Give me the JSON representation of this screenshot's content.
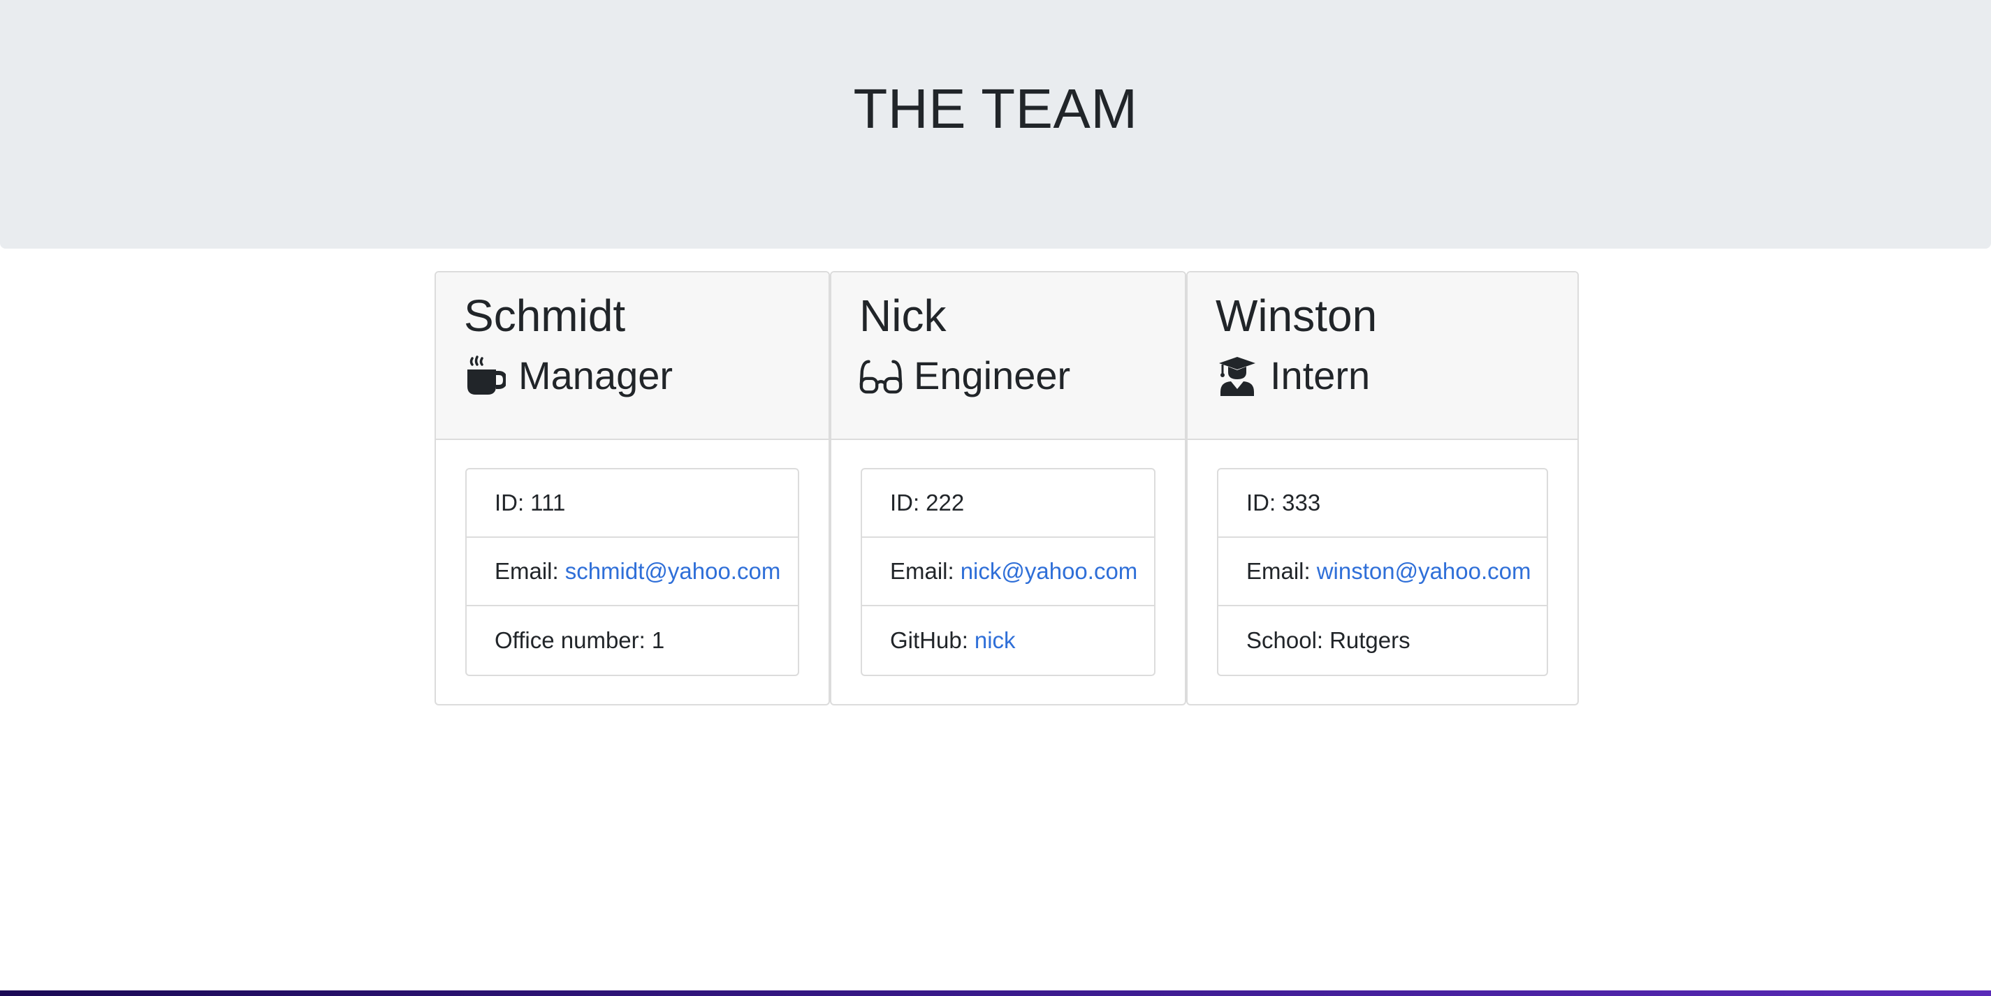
{
  "header": {
    "title": "THE TEAM"
  },
  "team": [
    {
      "name": "Schmidt",
      "role": "Manager",
      "icon": "coffee-mug-icon",
      "id_label": "ID:",
      "id": "111",
      "email_label": "Email:",
      "email": "schmidt@yahoo.com",
      "extra_label": "Office number:",
      "extra_value": "1"
    },
    {
      "name": "Nick",
      "role": "Engineer",
      "icon": "glasses-icon",
      "id_label": "ID:",
      "id": "222",
      "email_label": "Email:",
      "email": "nick@yahoo.com",
      "extra_label": "GitHub:",
      "extra_value": "nick"
    },
    {
      "name": "Winston",
      "role": "Intern",
      "icon": "graduate-icon",
      "id_label": "ID:",
      "id": "333",
      "email_label": "Email:",
      "email": "winston@yahoo.com",
      "extra_label": "School:",
      "extra_value": "Rutgers"
    }
  ],
  "colors": {
    "jumbotron_bg": "#e9ecef",
    "link": "#2f6fd8",
    "card_header_bg": "#f7f7f7",
    "border": "#dcdcdc"
  }
}
